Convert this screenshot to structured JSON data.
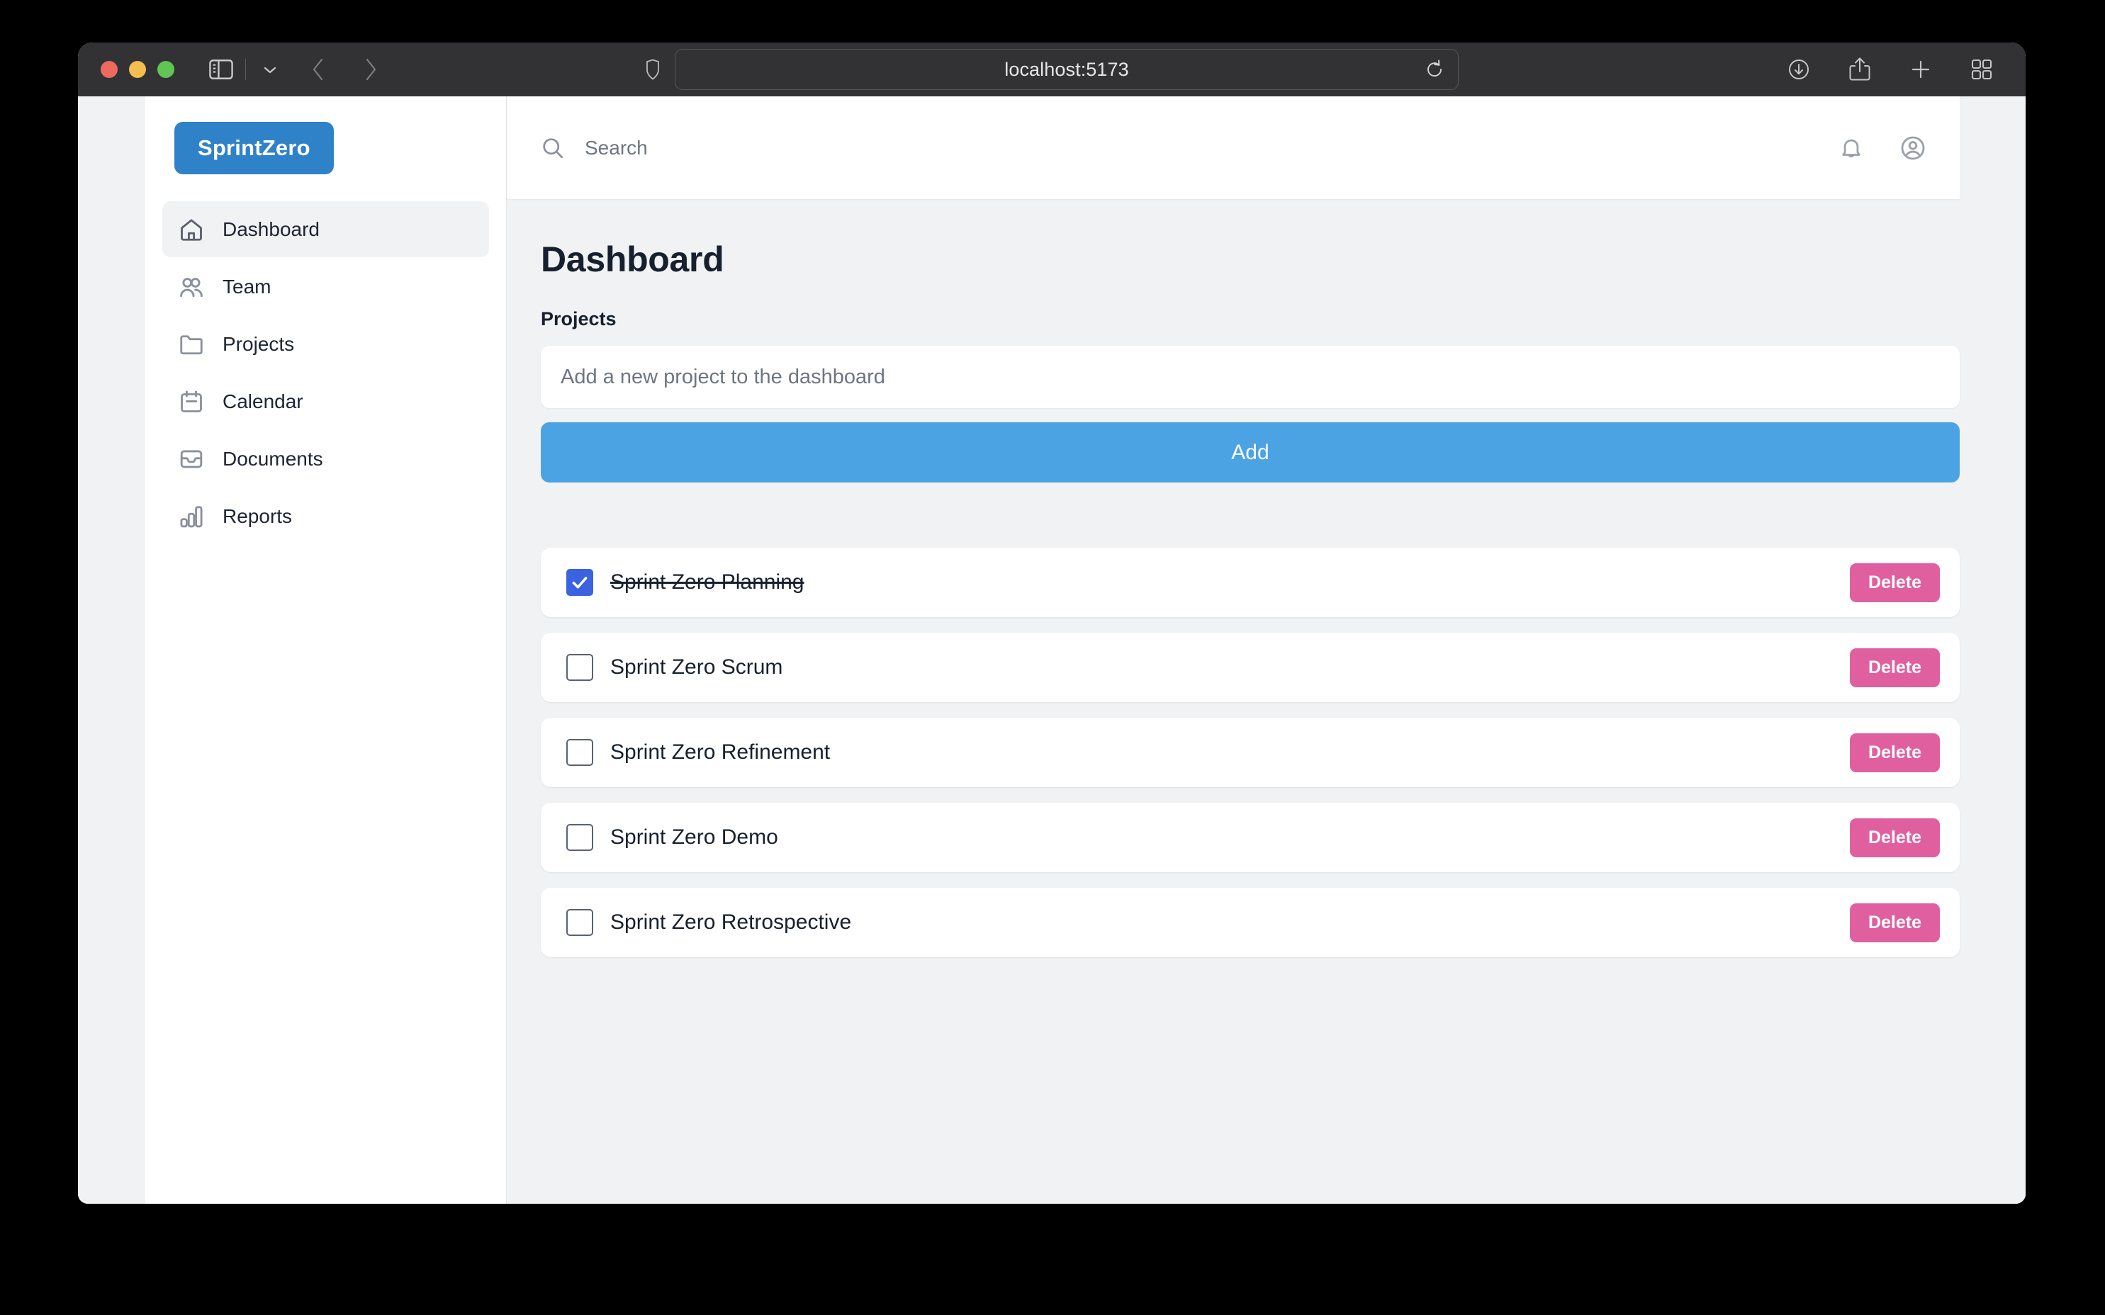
{
  "browser": {
    "url": "localhost:5173",
    "traffic_lights": [
      "close",
      "minimize",
      "zoom"
    ],
    "toolbar": {
      "sidebar_toggle": "sidebar-icon",
      "tab_group_chevron": "chevron-down-icon",
      "back": "chevron-left-icon",
      "forward": "chevron-right-icon",
      "privacy_shield": "shield-icon",
      "reload": "reload-icon",
      "downloads": "download-icon",
      "share": "share-icon",
      "new_tab": "plus-icon",
      "tab_overview": "grid-icon"
    }
  },
  "app": {
    "brand": "SprintZero",
    "sidebar": {
      "items": [
        {
          "label": "Dashboard",
          "icon": "home-icon",
          "active": true
        },
        {
          "label": "Team",
          "icon": "users-icon",
          "active": false
        },
        {
          "label": "Projects",
          "icon": "folder-icon",
          "active": false
        },
        {
          "label": "Calendar",
          "icon": "calendar-icon",
          "active": false
        },
        {
          "label": "Documents",
          "icon": "inbox-icon",
          "active": false
        },
        {
          "label": "Reports",
          "icon": "bar-chart-icon",
          "active": false
        }
      ]
    },
    "topbar": {
      "search_placeholder": "Search",
      "search_value": "",
      "notifications_icon": "bell-icon",
      "account_icon": "user-circle-icon"
    },
    "page": {
      "title": "Dashboard",
      "section_label": "Projects",
      "new_project_placeholder": "Add a new project to the dashboard",
      "new_project_value": "",
      "add_button_label": "Add",
      "delete_button_label": "Delete",
      "projects": [
        {
          "name": "Sprint Zero Planning",
          "done": true
        },
        {
          "name": "Sprint Zero Scrum",
          "done": false
        },
        {
          "name": "Sprint Zero Refinement",
          "done": false
        },
        {
          "name": "Sprint Zero Demo",
          "done": false
        },
        {
          "name": "Sprint Zero Retrospective",
          "done": false
        }
      ]
    }
  },
  "colors": {
    "brand_blue": "#3082c8",
    "add_button_blue": "#4ba3e3",
    "delete_pink": "#e0609f",
    "checkbox_blue": "#3b63e0",
    "page_bg": "#f1f2f4",
    "titlebar": "#323234"
  }
}
